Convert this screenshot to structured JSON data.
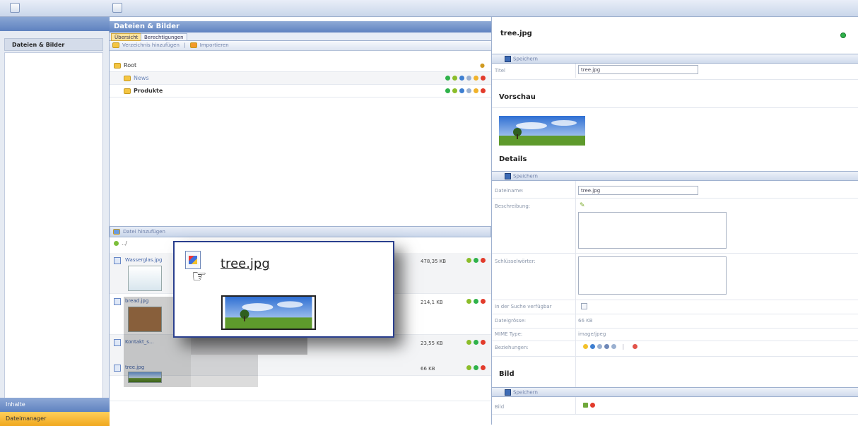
{
  "sidebar": {
    "items": [
      {
        "label": "Dateien & Bilder"
      }
    ],
    "bottom_tabs": [
      {
        "label": "Inhalte"
      },
      {
        "label": "Dateimanager"
      }
    ]
  },
  "mid": {
    "title": "Dateien & Bilder",
    "tabs": [
      {
        "label": "Übersicht"
      },
      {
        "label": "Berechtigungen"
      }
    ],
    "toolbar": {
      "add_folder": "Verzeichnis hinzufügen",
      "import": "Importieren"
    },
    "tree": [
      {
        "label": "Root"
      },
      {
        "label": "News"
      },
      {
        "label": "Produkte"
      }
    ],
    "files_toolbar": {
      "add_file": "Datei hinzufügen"
    },
    "path": "../",
    "files": [
      {
        "name": "Wasserglas.jpg",
        "size": "478,35 KB"
      },
      {
        "name": "bread.jpg",
        "size": "214,1 KB"
      },
      {
        "name": "Kontakt_s...",
        "size": "23,55 KB"
      },
      {
        "name": "tree.jpg",
        "size": "66 KB"
      }
    ]
  },
  "popup": {
    "filename": "tree.jpg"
  },
  "right": {
    "title": "tree.jpg",
    "save_label": "Speichern",
    "title_label": "Titel",
    "title_value": "tree.jpg",
    "preview_heading": "Vorschau",
    "details_heading": "Details",
    "fields": {
      "filename_label": "Dateiname:",
      "filename_value": "tree.jpg",
      "description_label": "Beschreibung:",
      "keywords_label": "Schlüsselwörter:",
      "searchable_label": "In der Suche verfügbar",
      "filesize_label": "Dateigrösse:",
      "filesize_value": "66 KB",
      "mime_label": "MIME Type:",
      "mime_value": "image/jpeg",
      "relations_label": "Beziehungen:"
    },
    "image_heading": "Bild",
    "image_label": "Bild"
  }
}
